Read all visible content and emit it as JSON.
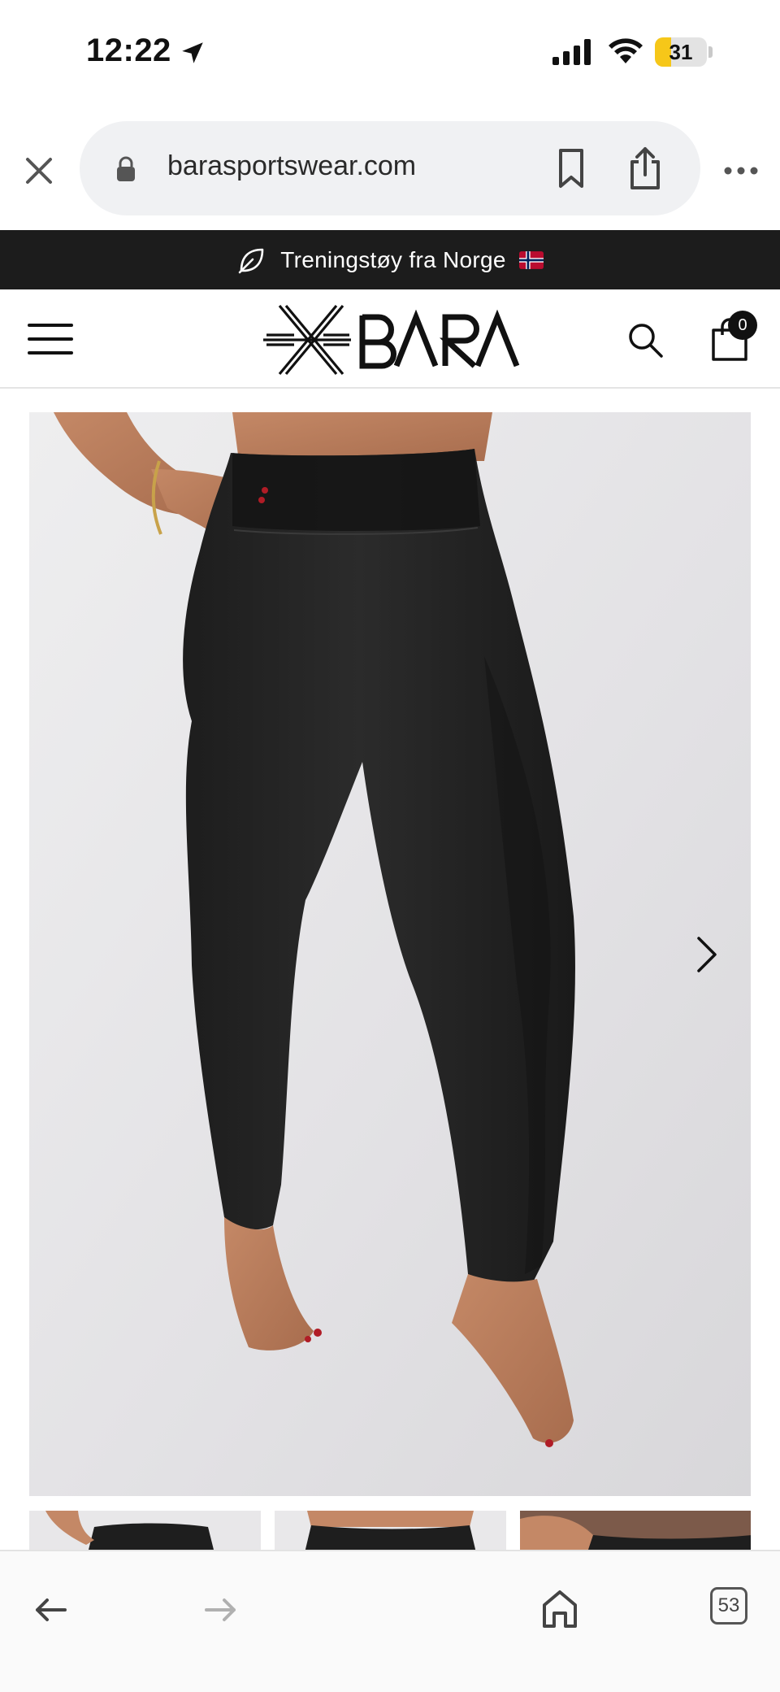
{
  "status_bar": {
    "time": "12:22",
    "battery_level": "31",
    "battery_fraction": 0.31,
    "battery_color": "#f6c719",
    "icons": [
      "location-arrow-icon",
      "cellular-signal-icon",
      "wifi-icon",
      "battery-icon"
    ]
  },
  "browser": {
    "url": "barasportswear.com",
    "icons": [
      "close-icon",
      "lock-icon",
      "bookmark-icon",
      "share-icon",
      "more-icon"
    ],
    "toolbar": {
      "tab_count": "53",
      "icons": [
        "back-arrow-icon",
        "forward-arrow-icon",
        "home-icon",
        "tabs-icon"
      ]
    }
  },
  "announcement": {
    "text": "Treningstøy fra Norge",
    "icons": [
      "leaf-icon",
      "norway-flag-icon"
    ],
    "background": "#1c1c1c"
  },
  "site_header": {
    "logo_text": "BARA",
    "cart_count": "0",
    "icons": [
      "hamburger-menu-icon",
      "search-icon",
      "shopping-bag-icon"
    ]
  },
  "product_gallery": {
    "main_image": "black high-waisted leggings on model, studio backdrop",
    "thumbnail_count": 3,
    "icons": [
      "chevron-right-icon"
    ]
  }
}
